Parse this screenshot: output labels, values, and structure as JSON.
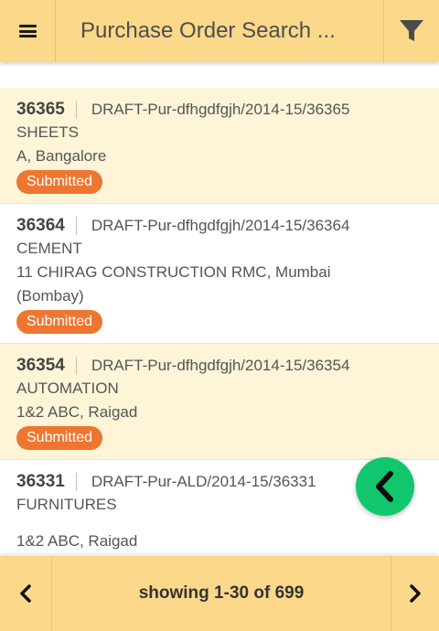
{
  "header": {
    "title": "Purchase Order Search ...",
    "menu_icon": "hamburger-menu-icon",
    "filter_icon": "filter-icon"
  },
  "orders": [
    {
      "number": "36365",
      "code": "DRAFT-Pur-dfhgdfgjh/2014-15/36365",
      "category": "SHEETS",
      "vendor": "A, Bangalore",
      "vendor_cont": "",
      "status": "Submitted"
    },
    {
      "number": "36364",
      "code": "DRAFT-Pur-dfhgdfgjh/2014-15/36364",
      "category": "CEMENT",
      "vendor": "11 CHIRAG CONSTRUCTION RMC, Mumbai",
      "vendor_cont": "(Bombay)",
      "status": "Submitted"
    },
    {
      "number": "36354",
      "code": "DRAFT-Pur-dfhgdfgjh/2014-15/36354",
      "category": "AUTOMATION",
      "vendor": "1&2 ABC, Raigad",
      "vendor_cont": "",
      "status": "Submitted"
    },
    {
      "number": "36331",
      "code": "DRAFT-Pur-ALD/2014-15/36331",
      "category": "FURNITURES",
      "vendor": "1&2 ABC, Raigad",
      "vendor_cont": "",
      "status": ""
    }
  ],
  "colors": {
    "header_bg": "#fcd88a",
    "status_badge": "#ee7630",
    "fab": "#12c66e"
  },
  "fab": {
    "icon": "chevron-left-icon"
  },
  "footer": {
    "paging": "showing 1-30 of 699",
    "prev_icon": "chevron-left-icon",
    "next_icon": "chevron-right-icon"
  }
}
